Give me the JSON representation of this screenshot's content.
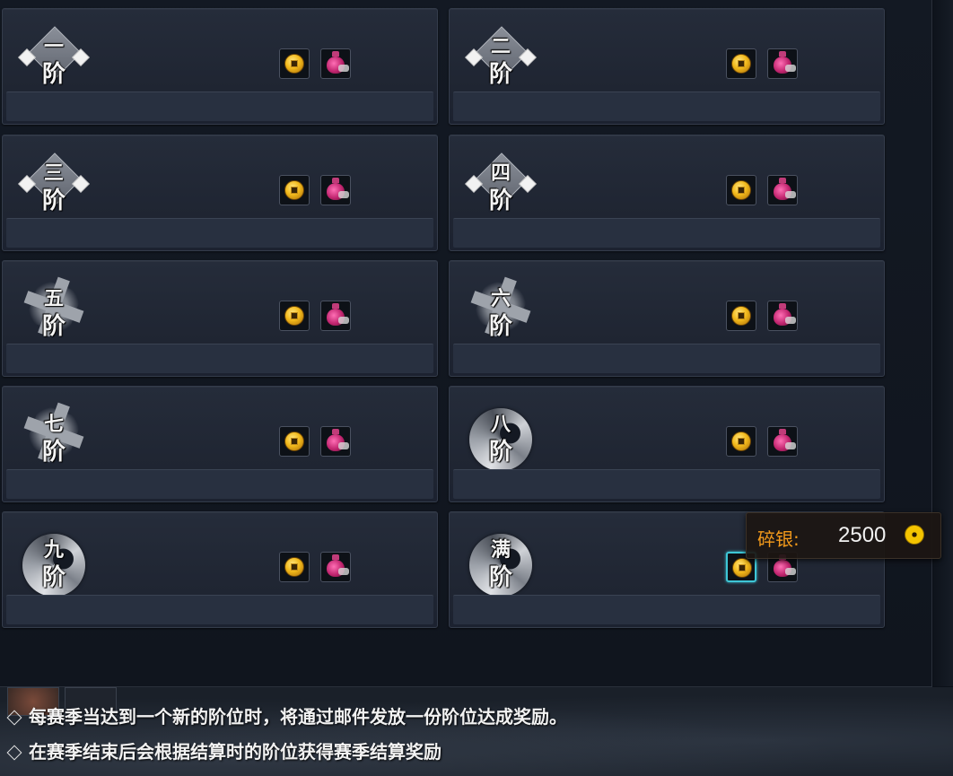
{
  "ranks": [
    {
      "id": "r1",
      "top": "一",
      "bottom": "阶",
      "style": "diamond"
    },
    {
      "id": "r2",
      "top": "二",
      "bottom": "阶",
      "style": "diamond"
    },
    {
      "id": "r3",
      "top": "三",
      "bottom": "阶",
      "style": "diamond"
    },
    {
      "id": "r4",
      "top": "四",
      "bottom": "阶",
      "style": "diamond"
    },
    {
      "id": "r5",
      "top": "五",
      "bottom": "阶",
      "style": "splash"
    },
    {
      "id": "r6",
      "top": "六",
      "bottom": "阶",
      "style": "splash"
    },
    {
      "id": "r7",
      "top": "七",
      "bottom": "阶",
      "style": "splash"
    },
    {
      "id": "r8",
      "top": "八",
      "bottom": "阶",
      "style": "swirl"
    },
    {
      "id": "r9",
      "top": "九",
      "bottom": "阶",
      "style": "swirl"
    },
    {
      "id": "r10",
      "top": "满",
      "bottom": "阶",
      "style": "swirl"
    }
  ],
  "reward_icons": [
    "coin-icon",
    "pouch-icon"
  ],
  "tooltip": {
    "label": "碎银:",
    "value": "2500",
    "icon": "coin-icon"
  },
  "notes": [
    "每赛季当达到一个新的阶位时，将通过邮件发放一份阶位达成奖励。",
    "在赛季结束后会根据结算时的阶位获得赛季结算奖励"
  ],
  "colors": {
    "tooltip_label": "#f39a1b",
    "selected_slot": "#3ec6d6",
    "card_bg": "#232a37"
  }
}
